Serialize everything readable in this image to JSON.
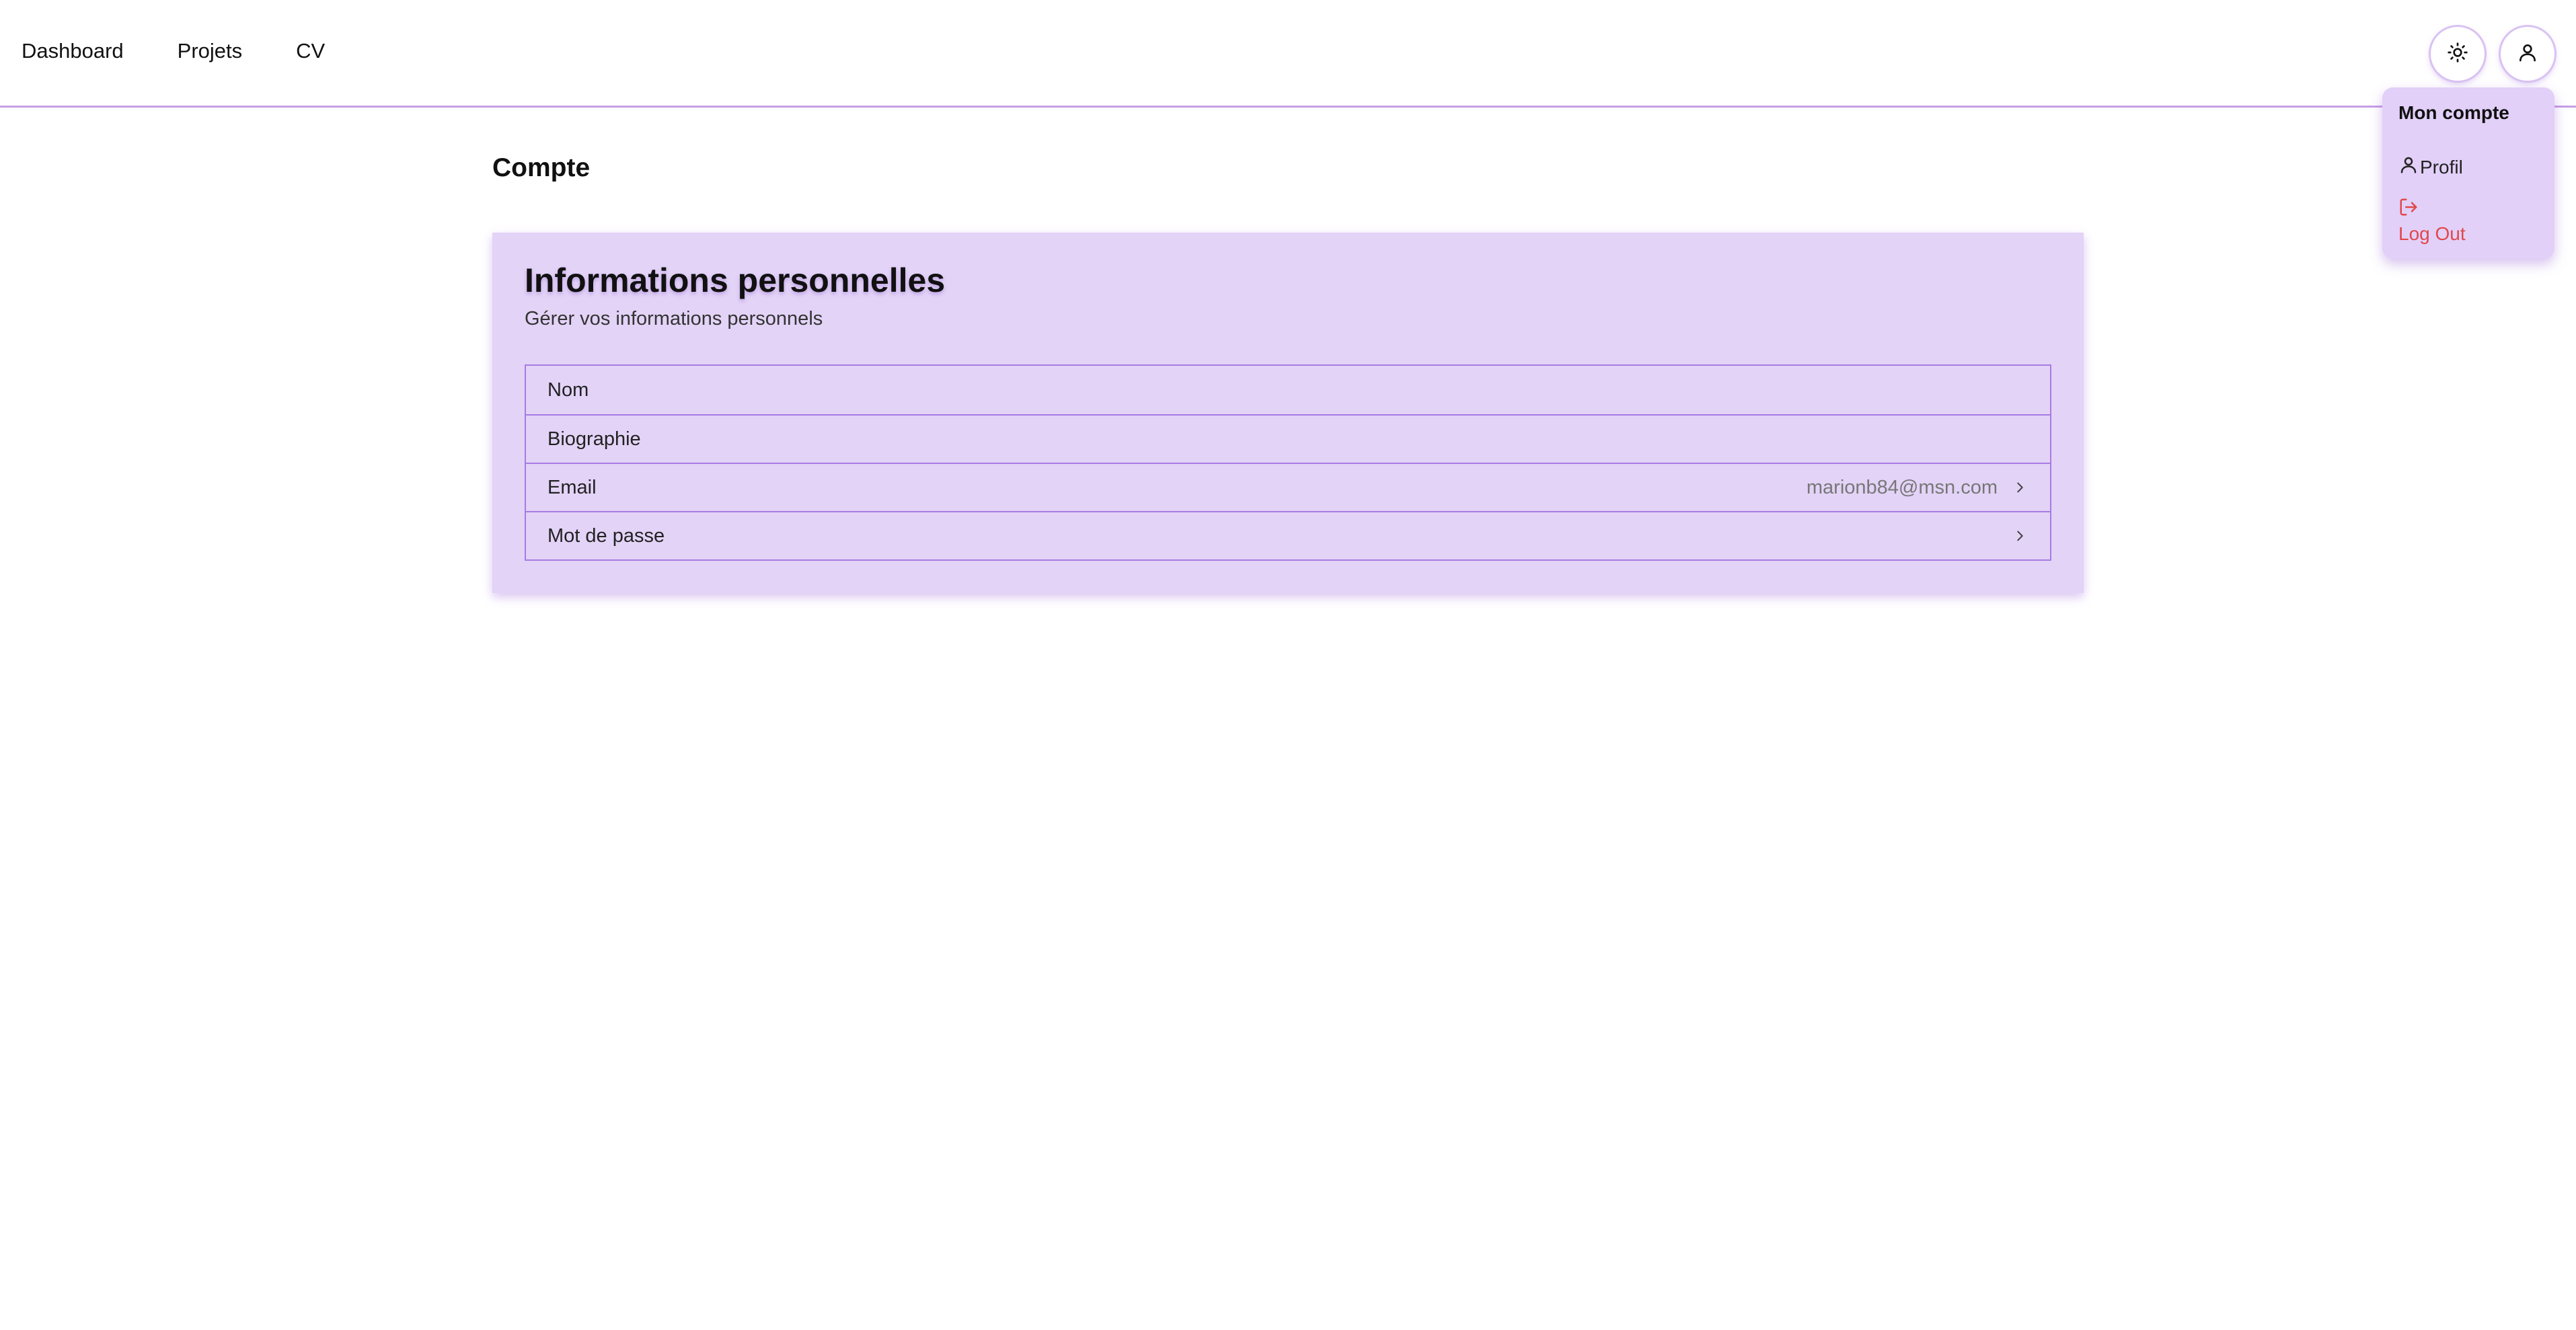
{
  "nav": {
    "links": [
      "Dashboard",
      "Projets",
      "CV"
    ],
    "theme_icon": "sun-icon",
    "user_icon": "user-icon"
  },
  "dropdown": {
    "title": "Mon compte",
    "profile_label": "Profil",
    "profile_icon": "user-icon",
    "logout_label": "Log Out",
    "logout_icon": "log-out-icon"
  },
  "page": {
    "title": "Compte"
  },
  "card": {
    "title": "Informations personnelles",
    "subtitle": "Gérer vos informations personnels",
    "rows": [
      {
        "label": "Nom",
        "value": ""
      },
      {
        "label": "Biographie",
        "value": ""
      },
      {
        "label": "Email",
        "value": "marionb84@msn.com",
        "chevron": true
      },
      {
        "label": "Mot de passe",
        "value": "",
        "chevron": true
      }
    ]
  },
  "colors": {
    "accent": "#a77be3",
    "card_bg": "#e3d3f7",
    "logout": "#e0484c"
  }
}
